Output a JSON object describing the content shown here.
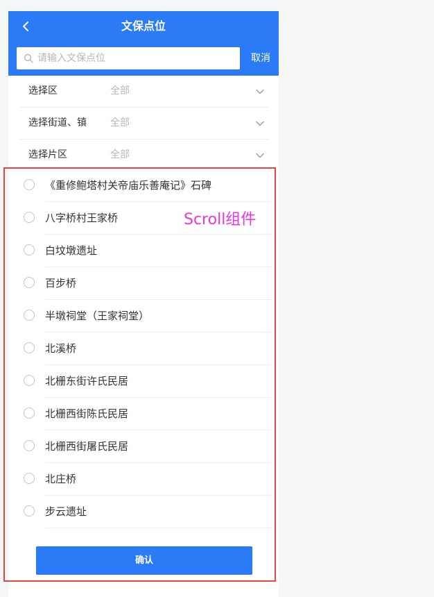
{
  "header": {
    "title": "文保点位",
    "back_icon": "chevron-left-icon"
  },
  "search": {
    "placeholder": "请输入文保点位",
    "value": "",
    "cancel_label": "取消"
  },
  "filters": [
    {
      "label": "选择区",
      "value": "全部"
    },
    {
      "label": "选择街道、镇",
      "value": "全部"
    },
    {
      "label": "选择片区",
      "value": "全部"
    }
  ],
  "options": [
    {
      "label": "《重修鲍塔村关帝庙乐善庵记》石碑"
    },
    {
      "label": "八字桥村王家桥"
    },
    {
      "label": "白坟墩遗址"
    },
    {
      "label": "百步桥"
    },
    {
      "label": "半墩祠堂（王家祠堂）"
    },
    {
      "label": "北溪桥"
    },
    {
      "label": "北栅东街许氏民居"
    },
    {
      "label": "北栅西街陈氏民居"
    },
    {
      "label": "北栅西街屠氏民居"
    },
    {
      "label": "北庄桥"
    },
    {
      "label": "步云遗址"
    }
  ],
  "confirm_label": "确认",
  "annotation": {
    "label": "Scroll组件"
  },
  "colors": {
    "primary": "#2a7bf5",
    "annotation_border": "#e9443e",
    "annotation_text": "#f233e3"
  }
}
